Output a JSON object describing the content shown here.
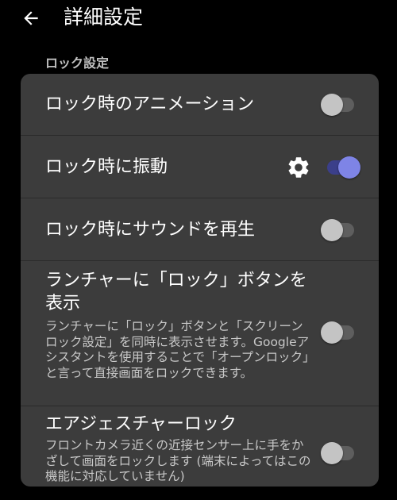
{
  "app_bar": {
    "title": "詳細設定",
    "back_icon": "arrow-left-icon"
  },
  "section": {
    "header": "ロック設定"
  },
  "colors": {
    "background": "#000000",
    "card": "#3c3c3c",
    "switch_on_thumb": "#7e84e6",
    "switch_on_track": "#3b3f8a",
    "switch_off_thumb": "#c4c4c4",
    "switch_off_track": "#5e5e5e"
  },
  "settings": [
    {
      "title": "ロック時のアニメーション",
      "enabled": false
    },
    {
      "title": "ロック時に振動",
      "enabled": true,
      "extra_icon": "gear-icon"
    },
    {
      "title": "ロック時にサウンドを再生",
      "enabled": false
    },
    {
      "title": "ランチャーに「ロック」ボタンを表示",
      "summary": "ランチャーに「ロック」ボタンと「スクリーンロック設定」を同時に表示させます。Googleアシスタントを使用することで「オープンロック」と言って直接画面をロックできます。",
      "enabled": false
    },
    {
      "title": "エアジェスチャーロック",
      "summary": "フロントカメラ近くの近接センサー上に手をかざして画面をロックします (端末によってはこの機能に対応していません)",
      "enabled": false
    }
  ]
}
